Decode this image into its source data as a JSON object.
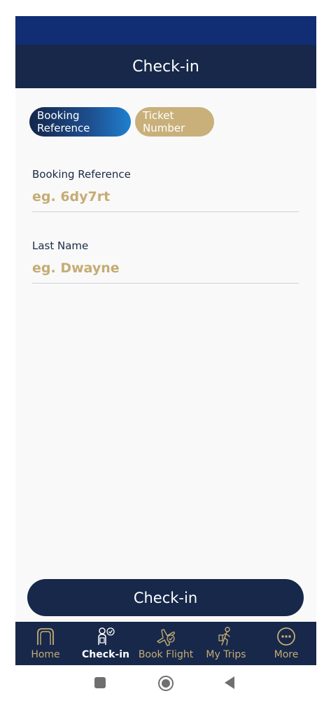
{
  "header": {
    "title": "Check-in"
  },
  "tabs": [
    {
      "label": "Booking Reference",
      "active": true
    },
    {
      "label": "Ticket Number",
      "active": false
    }
  ],
  "form": {
    "booking_reference": {
      "label": "Booking Reference",
      "placeholder": "eg. 6dy7rt",
      "value": ""
    },
    "last_name": {
      "label": "Last Name",
      "placeholder": "eg. Dwayne",
      "value": ""
    }
  },
  "submit_label": "Check-in",
  "bottom_nav": {
    "active": "Check-in",
    "items": [
      {
        "label": "Home",
        "icon": "home-arch-icon"
      },
      {
        "label": "Check-in",
        "icon": "check-in-person-icon"
      },
      {
        "label": "Book Flight",
        "icon": "plane-icon"
      },
      {
        "label": "My Trips",
        "icon": "traveler-icon"
      },
      {
        "label": "More",
        "icon": "more-dots-icon"
      }
    ]
  },
  "colors": {
    "primary_navy": "#17284a",
    "status_blue": "#112d74",
    "gold": "#c5ac74",
    "background": "#f9f9f9"
  }
}
